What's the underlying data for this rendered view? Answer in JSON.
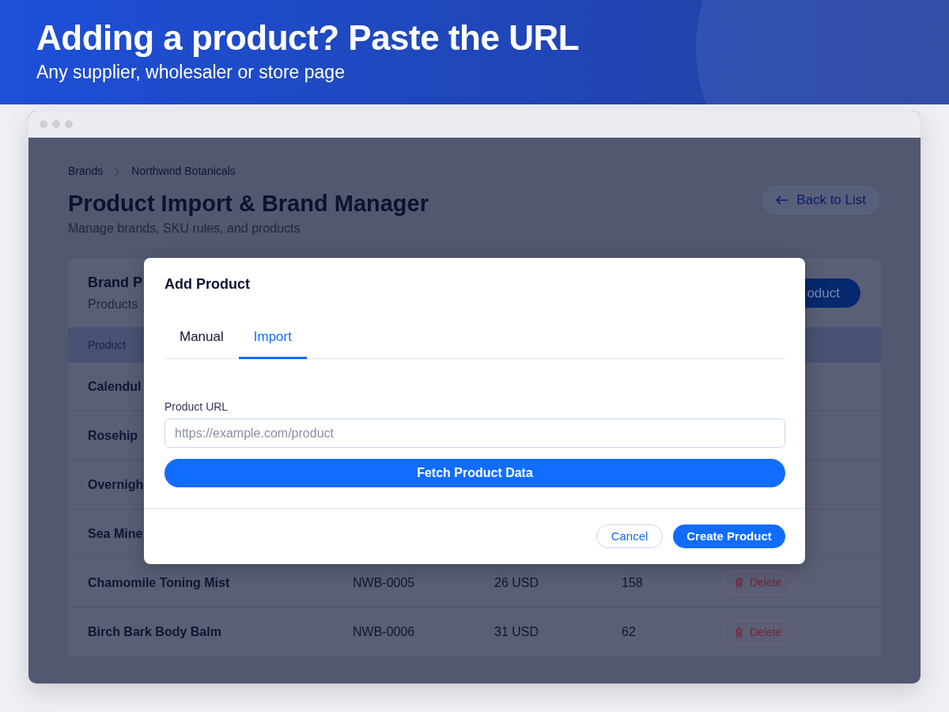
{
  "banner": {
    "title": "Adding a product? Paste the URL",
    "subtitle": "Any supplier, wholesaler or store page"
  },
  "breadcrumb": [
    "Brands",
    "Northwind Botanicals"
  ],
  "page": {
    "title": "Product Import & Brand Manager",
    "subtitle": "Manage brands, SKU rules, and products",
    "back_button": "Back to List"
  },
  "card": {
    "title": "Brand P",
    "subtitle": "Products",
    "add_button": "oduct"
  },
  "table": {
    "columns": [
      "Product"
    ],
    "rows": [
      {
        "name": "Calendul"
      },
      {
        "name": "Rosehip"
      },
      {
        "name": "Overnigh"
      },
      {
        "name": "Sea Mine"
      },
      {
        "name": "Chamomile Toning Mist",
        "sku": "NWB-0005",
        "price": "26 USD",
        "stock": "158",
        "action": "Delete"
      },
      {
        "name": "Birch Bark Body Balm",
        "sku": "NWB-0006",
        "price": "31 USD",
        "stock": "62",
        "action": "Delete"
      }
    ]
  },
  "modal": {
    "title": "Add Product",
    "tabs": [
      {
        "label": "Manual",
        "selected": false
      },
      {
        "label": "Import",
        "selected": true
      }
    ],
    "field_label": "Product URL",
    "placeholder": "https://example.com/product",
    "fetch_button": "Fetch Product Data",
    "cancel_button": "Cancel",
    "create_button": "Create Product"
  }
}
